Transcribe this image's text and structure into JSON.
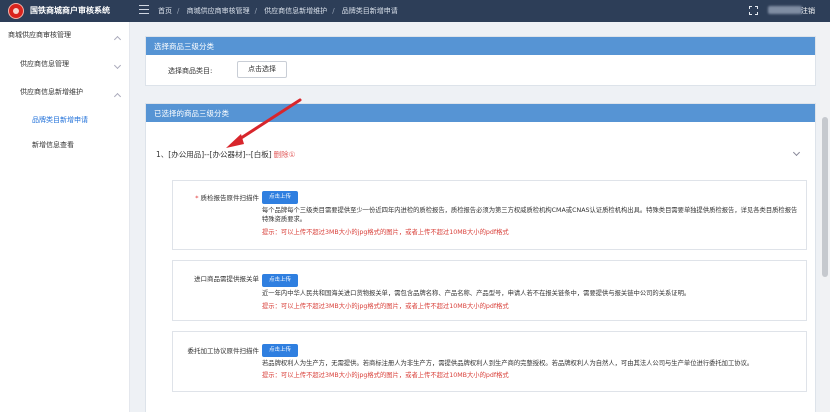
{
  "app": {
    "title": "国铁商城商户审核系统"
  },
  "header": {
    "breadcrumb": [
      "首页",
      "商城供应商审核管理",
      "供应商信息新增维护",
      "品牌类目新增申请"
    ],
    "logout_label": "注销"
  },
  "sidebar": {
    "items": [
      {
        "label": "商城供应商审核管理"
      },
      {
        "label": "供应商信息管理"
      },
      {
        "label": "供应商信息新增维护"
      },
      {
        "label": "品牌类目新增申请"
      },
      {
        "label": "新增信息查看"
      }
    ]
  },
  "section1": {
    "title": "选择商品三级分类",
    "field_label": "选择商品类目:",
    "button_label": "点击选择"
  },
  "section2": {
    "title": "已选择的商品三级分类",
    "selected_item": "1、[办公用品]--[办公器材]--[白板]",
    "delete_label": "删除①"
  },
  "documents": [
    {
      "required": "*",
      "label": "质检报告原件扫描件",
      "button": "点击上传",
      "description": "每个品牌每个三级类目需要提供至少一份近四年内进检的质检报告，质检报告必须为第三方权威质检机构CMA或CNAS认证质检机构出具。特殊类目需要单独提供质检报告，详见各类目质检报告特殊资质要求。",
      "tip": "提示：可以上传不超过3MB大小的jpg格式的图片，或者上传不超过10MB大小的pdf格式"
    },
    {
      "required": "",
      "label": "进口商品需提供报关单",
      "button": "点击上传",
      "description": "近一年内中华人民共和国海关进口货物报关单，需包含品牌名称、产品名称、产品型号，申请人若不在报关链条中，需要提供与报关链中公司的关系证明。",
      "tip": "提示：可以上传不超过3MB大小的jpg格式的图片，或者上传不超过10MB大小的pdf格式"
    },
    {
      "required": "",
      "label": "委托加工协议原件扫描件",
      "button": "点击上传",
      "description": "若品牌权利人为生产方，无需提供。若商标注册人为非生产方，需提供品牌权利人到生产商的完整授权。若品牌权利人为自然人，可由其法人公司与生产单位进行委托加工协议。",
      "tip": "提示：可以上传不超过3MB大小的jpg格式的图片，或者上传不超过10MB大小的pdf格式"
    }
  ],
  "colors": {
    "topbar": "#2d3e58",
    "section_header": "#5694d4",
    "upload_button": "#2f7fe0",
    "annotation_arrow": "#d8262c",
    "tip_text": "#d9403a"
  },
  "icons": [
    "logo-icon",
    "menu-toggle-icon",
    "fullscreen-icon",
    "chevron-down-icon",
    "chevron-up-icon",
    "annotation-arrow"
  ]
}
